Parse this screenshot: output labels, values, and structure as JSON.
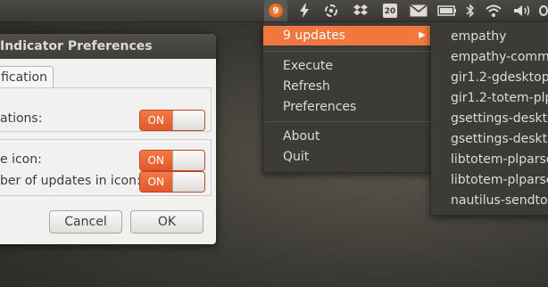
{
  "panel": {
    "calendar_day": "20",
    "icons": [
      "updates-gear-icon",
      "lightning-icon",
      "update-manager-icon",
      "dropbox-icon",
      "calendar-icon",
      "mail-icon",
      "battery-icon",
      "bluetooth-icon",
      "wifi-icon",
      "volume-icon"
    ],
    "updates_badge": "9"
  },
  "dialog": {
    "title": "Indicator Preferences",
    "tab_label": "fication",
    "rows": [
      {
        "label": "ations:",
        "switch": "ON"
      },
      {
        "label": "e icon:",
        "switch": "ON"
      },
      {
        "label": "ber of updates in icon:",
        "switch": "ON"
      }
    ],
    "cancel_label": "Cancel",
    "ok_label": "OK"
  },
  "menu": {
    "updates_label": "9 updates",
    "items": [
      "Execute",
      "Refresh",
      "Preferences"
    ],
    "items2": [
      "About",
      "Quit"
    ]
  },
  "submenu": {
    "items": [
      "empathy",
      "empathy-commo",
      "gir1.2-gdesktop",
      "gir1.2-totem-plp",
      "gsettings-deskto",
      "gsettings-deskto",
      "libtotem-plparse",
      "libtotem-plparse",
      "nautilus-sendto-"
    ]
  },
  "colors": {
    "accent": "#f0773d",
    "panel": "#3c3b37",
    "dialog_bg": "#f2f1f0"
  }
}
